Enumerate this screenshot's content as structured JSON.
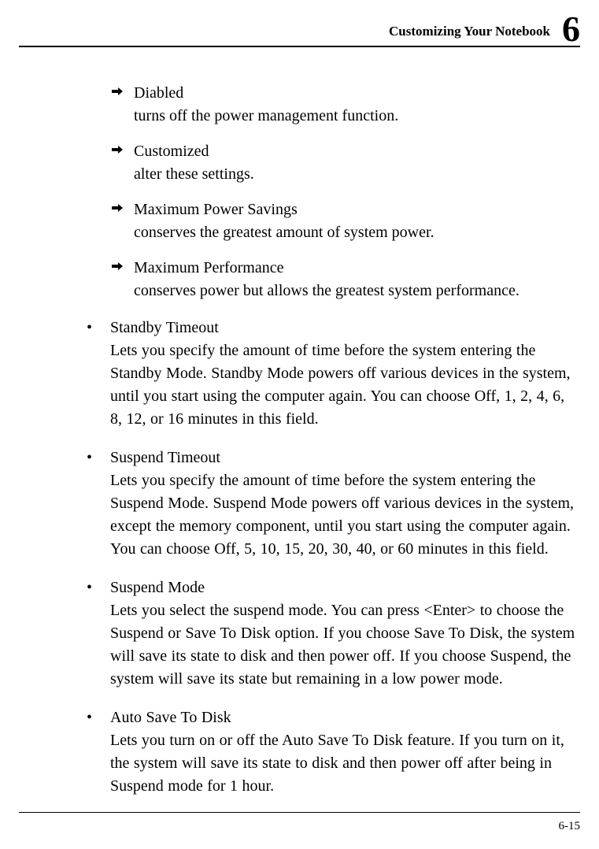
{
  "header": {
    "title": "Customizing Your Notebook",
    "chapter_number": "6"
  },
  "sub_items": [
    {
      "title": "Diabled",
      "desc": "turns off the power management function."
    },
    {
      "title": "Customized",
      "desc": "alter these settings."
    },
    {
      "title": "Maximum Power Savings",
      "desc": "conserves the greatest amount of system power."
    },
    {
      "title": "Maximum Performance",
      "desc": "conserves power but allows the greatest system performance."
    }
  ],
  "main_items": [
    {
      "title": "Standby Timeout",
      "desc": "Lets you specify the amount of time before the system entering the Standby Mode. Standby Mode powers off various devices in the system, until you start using the computer again. You can choose Off, 1, 2, 4, 6, 8, 12, or 16 minutes in this field."
    },
    {
      "title": "Suspend Timeout",
      "desc": "Lets you specify the amount of time before the system entering the Suspend Mode. Suspend Mode powers off various devices in the system, except the memory component, until you start using the computer again. You can choose Off, 5, 10, 15, 20, 30, 40, or 60 minutes in this field."
    },
    {
      "title": "Suspend Mode",
      "desc": "Lets you select the suspend mode. You can press <Enter> to choose the Suspend or Save To Disk option. If you choose Save To Disk, the system will save its state to disk and then power off. If you choose Suspend, the system will save its state but remaining in a low power mode."
    },
    {
      "title": "Auto Save To Disk",
      "desc": "Lets you turn on or off the Auto Save To Disk feature. If you turn on it, the system will save its state to disk and then power off after being in Suspend mode for 1 hour."
    }
  ],
  "footer": {
    "page_number": "6-15"
  }
}
